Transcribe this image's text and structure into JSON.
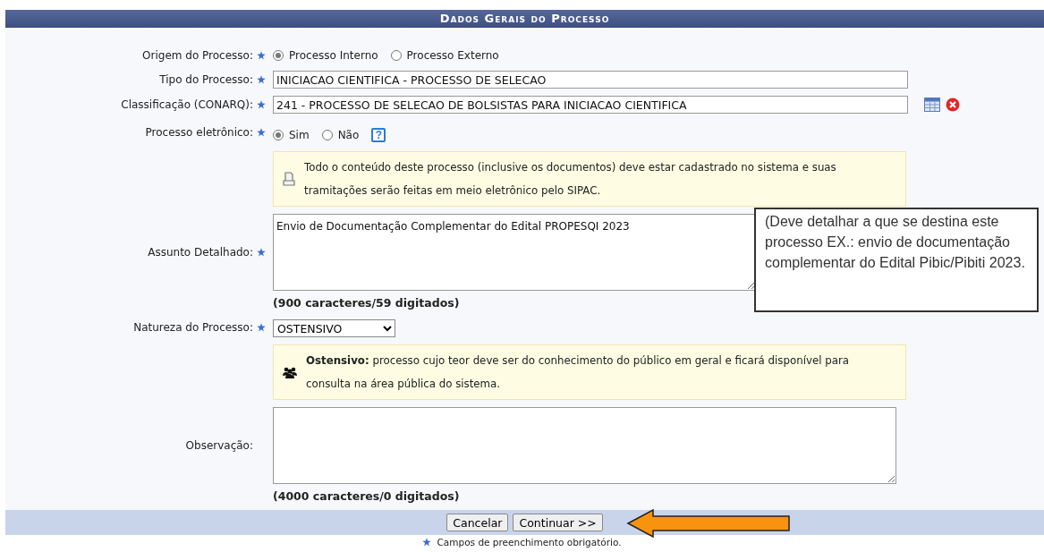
{
  "panel": {
    "title": "Dados Gerais do Processo"
  },
  "rows": [
    {
      "kind": "radio",
      "label": "Origem do Processo:",
      "required": true,
      "options": [
        {
          "label": "Processo Interno",
          "selected": true
        },
        {
          "label": "Processo Externo",
          "selected": false
        }
      ]
    },
    {
      "kind": "text",
      "label": "Tipo do Processo:",
      "required": true,
      "value": "INICIACAO CIENTIFICA - PROCESSO DE SELECAO"
    },
    {
      "kind": "lookup",
      "label": "Classificação (CONARQ):",
      "required": true,
      "value": "241 - PROCESSO DE SELECAO DE BOLSISTAS PARA INICIACAO CIENTIFICA"
    },
    {
      "kind": "radio",
      "label": "Processo eletrônico:",
      "required": true,
      "options": [
        {
          "label": "Sim",
          "selected": true
        },
        {
          "label": "Não",
          "selected": false
        }
      ],
      "help": "?"
    },
    {
      "kind": "note",
      "text": "Todo o conteúdo deste processo (inclusive os documentos) deve estar cadastrado no sistema e suas tramitações serão feitas em meio eletrônico pelo SIPAC."
    },
    {
      "kind": "textarea",
      "label": "Assunto Detalhado:",
      "required": true,
      "value": "Envio de Documentação Complementar do Edital PROPESQI 2023",
      "counter": "(900 caracteres/59 digitados)"
    },
    {
      "kind": "select",
      "label": "Natureza do Processo:",
      "required": true,
      "value": "OSTENSIVO"
    },
    {
      "kind": "note",
      "text": "**Ostensivo:** processo cujo teor deve ser do conhecimento do público em geral e ficará disponível para consulta na área pública do sistema."
    },
    {
      "kind": "textarea",
      "label": "Observação:",
      "required": false,
      "value": "",
      "counter": "(4000 caracteres/0 digitados)"
    }
  ],
  "tooltip": {
    "text": "(Deve detalhar a que se destina este processo EX.: envio de documentação complementar do Edital Pibic/Pibiti 2023."
  },
  "buttons": [
    "Cancelar",
    "Continuar >>"
  ],
  "footer_note": "Campos de preenchimento obrigatório."
}
